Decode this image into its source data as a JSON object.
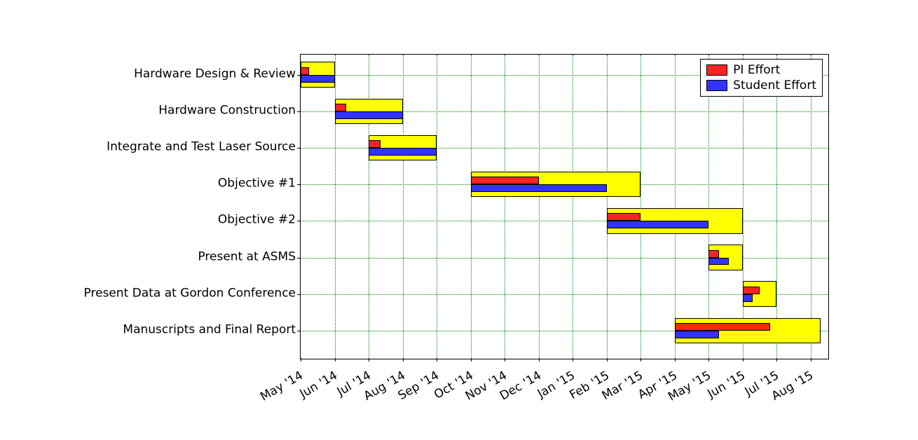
{
  "chart_data": {
    "type": "bar",
    "orientation": "gantt",
    "x_axis": {
      "labels": [
        "May '14",
        "Jun '14",
        "Jul '14",
        "Aug '14",
        "Sep '14",
        "Oct '14",
        "Nov '14",
        "Dec '14",
        "Jan '15",
        "Feb '15",
        "Mar '15",
        "Apr '15",
        "May '15",
        "Jun '15",
        "Jul '15",
        "Aug '15"
      ],
      "index_start": 0
    },
    "tasks": [
      {
        "name": "Hardware Design & Review",
        "total": {
          "start": 0,
          "end": 1
        },
        "pi": {
          "start": 0,
          "end": 0.25
        },
        "student": {
          "start": 0,
          "end": 1
        }
      },
      {
        "name": "Hardware Construction",
        "total": {
          "start": 1,
          "end": 3
        },
        "pi": {
          "start": 1,
          "end": 1.35
        },
        "student": {
          "start": 1,
          "end": 3
        }
      },
      {
        "name": "Integrate and Test Laser Source",
        "total": {
          "start": 2,
          "end": 4
        },
        "pi": {
          "start": 2,
          "end": 2.35
        },
        "student": {
          "start": 2,
          "end": 4
        }
      },
      {
        "name": "Objective #1",
        "total": {
          "start": 5,
          "end": 10
        },
        "pi": {
          "start": 5,
          "end": 7
        },
        "student": {
          "start": 5,
          "end": 9
        }
      },
      {
        "name": "Objective #2",
        "total": {
          "start": 9,
          "end": 13
        },
        "pi": {
          "start": 9,
          "end": 10
        },
        "student": {
          "start": 9,
          "end": 12
        }
      },
      {
        "name": "Present at ASMS",
        "total": {
          "start": 12,
          "end": 13
        },
        "pi": {
          "start": 12,
          "end": 12.3
        },
        "student": {
          "start": 12,
          "end": 12.6
        }
      },
      {
        "name": "Present Data at Gordon Conference",
        "total": {
          "start": 13,
          "end": 14
        },
        "pi": {
          "start": 13,
          "end": 13.5
        },
        "student": {
          "start": 13,
          "end": 13.3
        }
      },
      {
        "name": "Manuscripts and Final Report",
        "total": {
          "start": 11,
          "end": 15.3
        },
        "pi": {
          "start": 11,
          "end": 13.8
        },
        "student": {
          "start": 11,
          "end": 12.3
        }
      }
    ],
    "legend": {
      "pi": "PI Effort",
      "student": "Student Effort"
    },
    "colors": {
      "total": "#ffff00",
      "pi": "#ff2222",
      "student": "#3333ff"
    },
    "xlim_months": [
      0,
      15.5
    ],
    "ylabel": "",
    "xlabel": "",
    "title": ""
  }
}
